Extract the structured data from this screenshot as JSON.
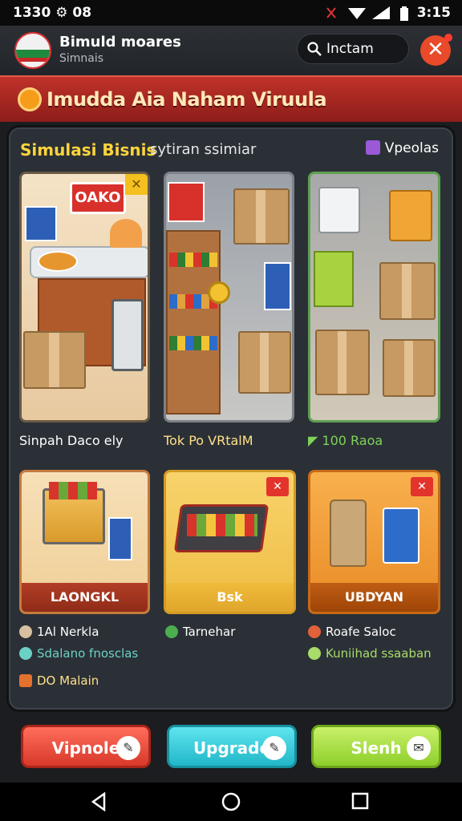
{
  "status": {
    "left": "1330 ⚙ 08",
    "right": "3:15"
  },
  "header": {
    "title": "Bimuld moares",
    "subtitle": "Simnais",
    "search_value": "Inctam",
    "close_symbol": "✕"
  },
  "banner": {
    "text": "Imudda Aia Naham Viruula"
  },
  "panel": {
    "title": "Simulasi Bisnis",
    "subtitle": "sytiran ssimiar",
    "link": "Vpeolas",
    "cards": [
      {
        "label": "Sinpah Daco ely",
        "sign": "OAKO",
        "corner": "✕"
      },
      {
        "label": "Tok Po VRtalM"
      },
      {
        "label": "100 Raoa"
      },
      {
        "strip": "LAONGKL",
        "meta1": "1Al Nerkla",
        "meta2": "Sdalano fnosclas",
        "meta3": "DO Malain"
      },
      {
        "strip": "Bsk",
        "meta1": "Tarnehar",
        "corner": "✕"
      },
      {
        "strip": "UBDYAN",
        "meta1": "Roafe Saloc",
        "meta2": "Kuniihad ssaaban",
        "corner": "✕"
      }
    ]
  },
  "actions": [
    {
      "label": "Vipnole",
      "icon": "✎"
    },
    {
      "label": "Upgrade",
      "icon": "✎"
    },
    {
      "label": "Slenh",
      "icon": "✉"
    }
  ],
  "colors": {
    "accent": "#ffd43b",
    "banner": "#c0322a"
  }
}
